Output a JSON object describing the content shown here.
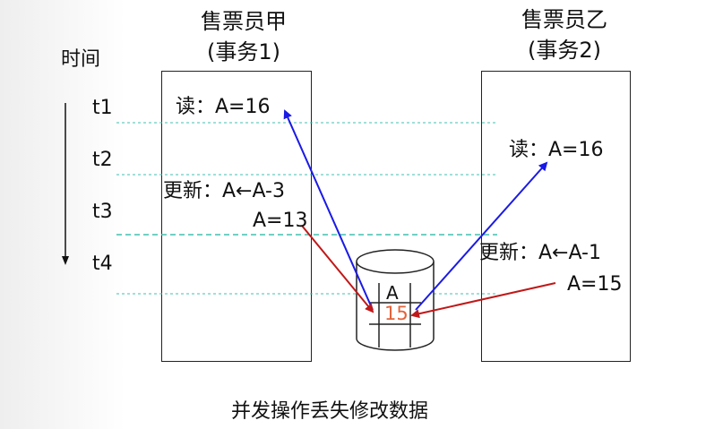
{
  "columns": {
    "left": {
      "title": "售票员甲",
      "subtitle": "(事务1)"
    },
    "right": {
      "title": "售票员乙",
      "subtitle": "(事务2)"
    }
  },
  "time_axis": {
    "label": "时间",
    "ticks": [
      "t1",
      "t2",
      "t3",
      "t4"
    ]
  },
  "left_ops": {
    "read": "读：A=16",
    "update": "更新：A←A-3",
    "result": "A=13"
  },
  "right_ops": {
    "read": "读：A=16",
    "update": "更新：A←A-1",
    "result": "A=15"
  },
  "database": {
    "item": "A",
    "value": "15"
  },
  "caption": "并发操作丢失修改数据",
  "colors": {
    "read_arrow": "#1a1ae6",
    "write_arrow": "#c01818",
    "dashed_line": "#40c0b0",
    "db_value": "#e4633a",
    "cell_highlight": "#b7dcef"
  }
}
